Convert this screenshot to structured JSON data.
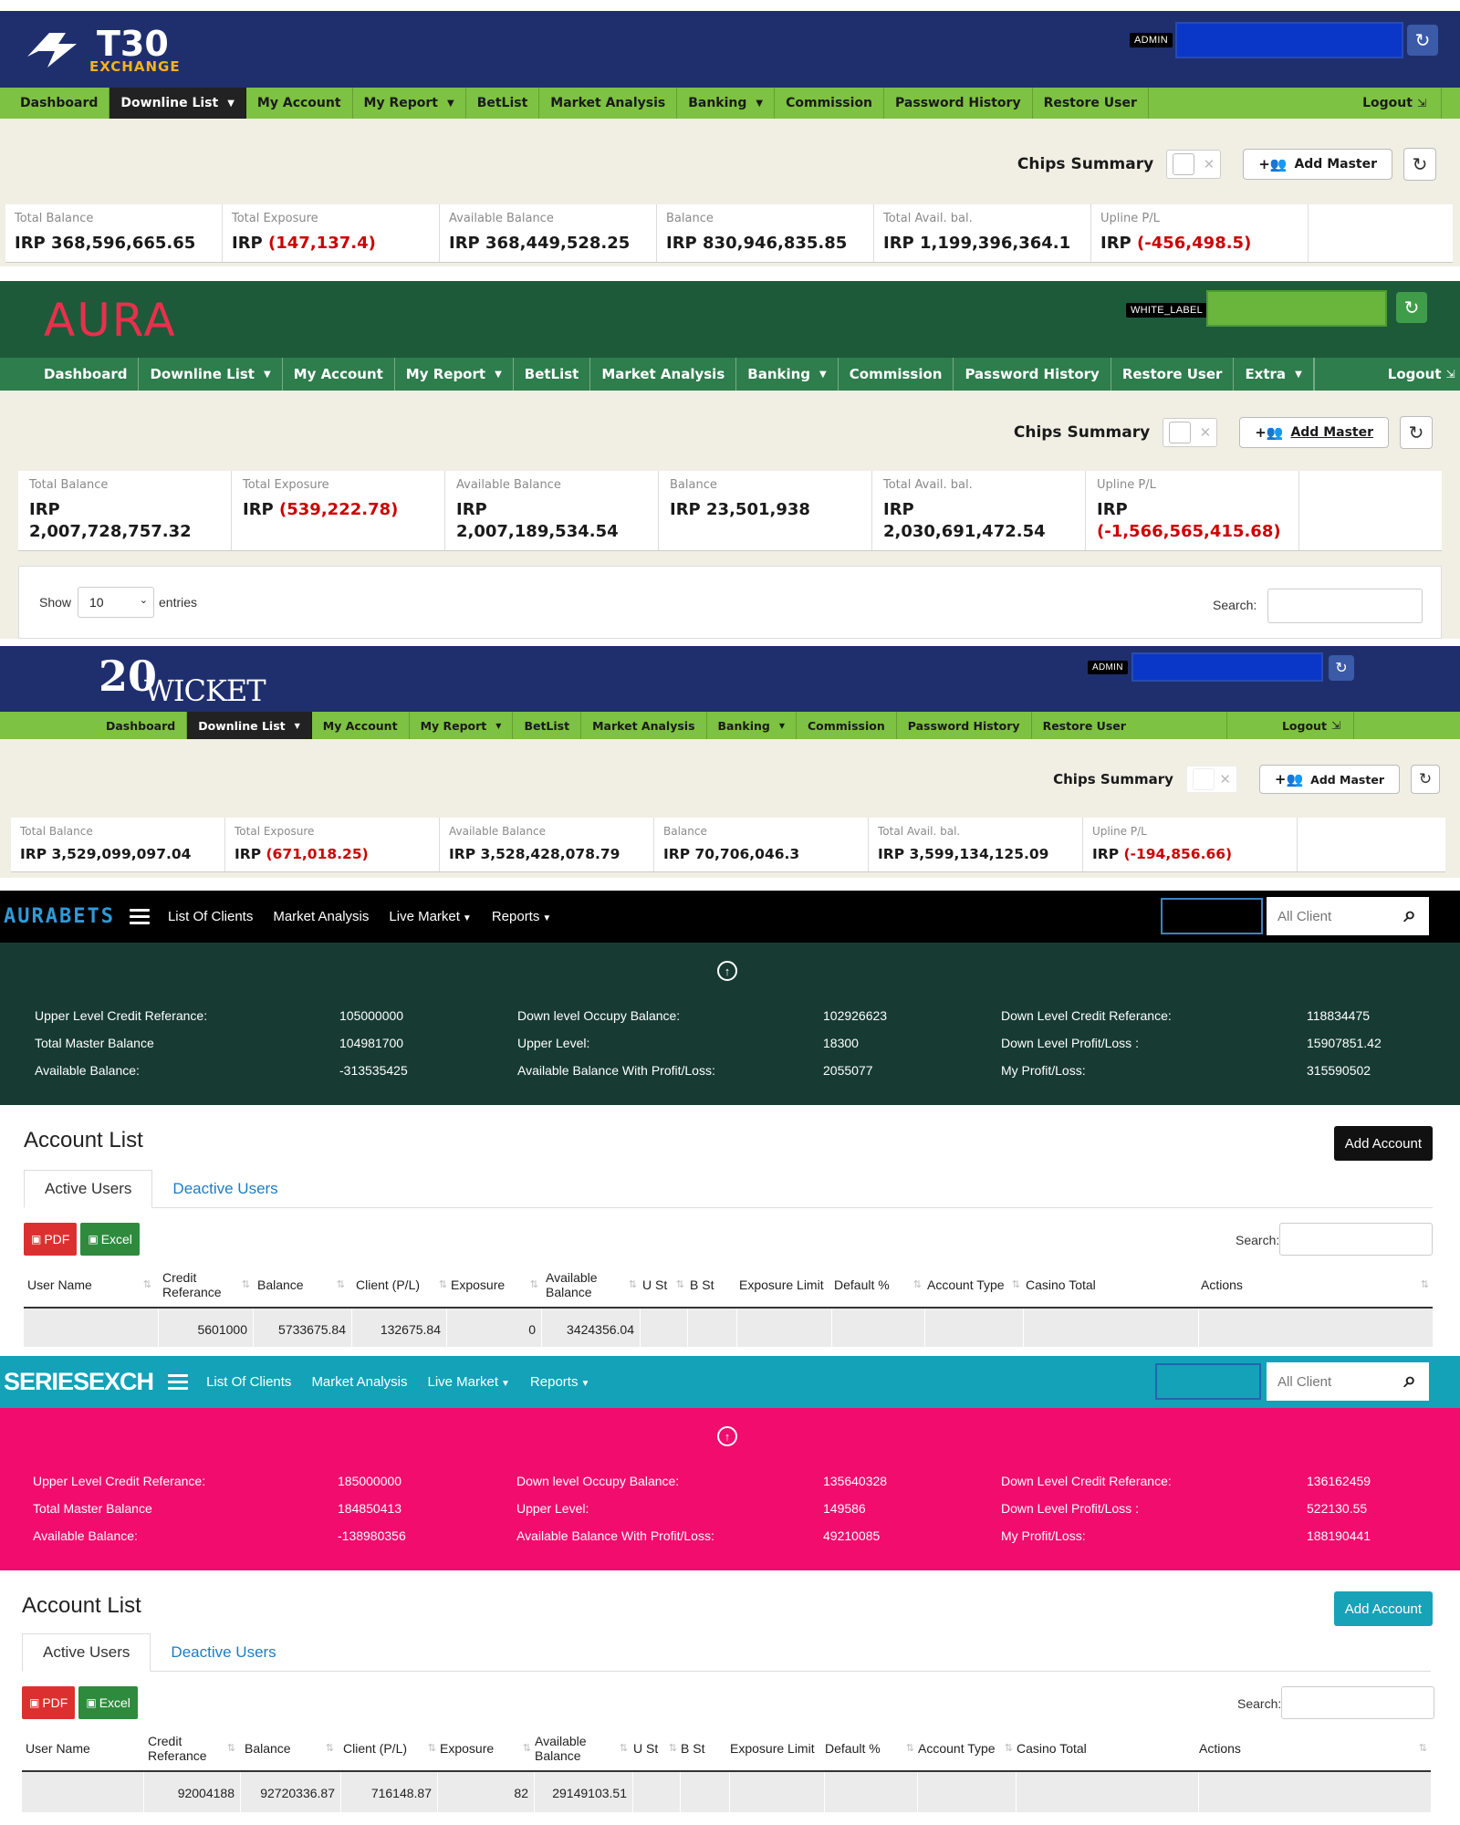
{
  "panels": [
    {
      "logo_main": "T30",
      "logo_sub": "EXCHANGE",
      "role_badge": "ADMIN",
      "nav": [
        {
          "label": "Dashboard"
        },
        {
          "label": "Downline List",
          "caret": true,
          "active": true
        },
        {
          "label": "My Account"
        },
        {
          "label": "My Report",
          "caret": true
        },
        {
          "label": "BetList"
        },
        {
          "label": "Market Analysis"
        },
        {
          "label": "Banking",
          "caret": true
        },
        {
          "label": "Commission"
        },
        {
          "label": "Password History"
        },
        {
          "label": "Restore User"
        }
      ],
      "logout": "Logout",
      "chips_summary": "Chips Summary",
      "add_master": "Add Master",
      "stats": [
        {
          "label": "Total Balance",
          "prefix": "IRP",
          "value": "368,596,665.65"
        },
        {
          "label": "Total Exposure",
          "prefix": "IRP",
          "value": "(147,137.4)",
          "negative": true
        },
        {
          "label": "Available Balance",
          "prefix": "IRP",
          "value": "368,449,528.25"
        },
        {
          "label": "Balance",
          "prefix": "IRP",
          "value": "830,946,835.85"
        },
        {
          "label": "Total Avail. bal.",
          "prefix": "IRP",
          "value": "1,199,396,364.1"
        },
        {
          "label": "Upline P/L",
          "prefix": "IRP",
          "value": "(-456,498.5)",
          "negative": true
        }
      ]
    },
    {
      "logo_main": "AURA",
      "role_badge": "WHITE_LABEL",
      "nav": [
        {
          "label": "Dashboard"
        },
        {
          "label": "Downline List",
          "caret": true
        },
        {
          "label": "My Account"
        },
        {
          "label": "My Report",
          "caret": true
        },
        {
          "label": "BetList"
        },
        {
          "label": "Market Analysis"
        },
        {
          "label": "Banking",
          "caret": true
        },
        {
          "label": "Commission"
        },
        {
          "label": "Password History"
        },
        {
          "label": "Restore User"
        },
        {
          "label": "Extra",
          "caret": true
        }
      ],
      "logout": "Logout",
      "chips_summary": "Chips Summary",
      "add_master": "Add Master",
      "stats": [
        {
          "label": "Total Balance",
          "prefix": "IRP",
          "value": "2,007,728,757.32"
        },
        {
          "label": "Total Exposure",
          "prefix": "IRP",
          "value": "(539,222.78)",
          "negative": true
        },
        {
          "label": "Available Balance",
          "prefix": "IRP",
          "value": "2,007,189,534.54"
        },
        {
          "label": "Balance",
          "prefix": "IRP",
          "value": "23,501,938"
        },
        {
          "label": "Total Avail. bal.",
          "prefix": "IRP",
          "value": "2,030,691,472.54"
        },
        {
          "label": "Upline P/L",
          "prefix": "IRP",
          "value": "(-1,566,565,415.68)",
          "negative": true,
          "wrap": true
        }
      ],
      "show_label": "Show",
      "show_value": "10",
      "entries_label": "entries",
      "search_label": "Search:"
    },
    {
      "logo_main": "WICKET",
      "logo_num": "20",
      "role_badge": "ADMIN",
      "nav": [
        {
          "label": "Dashboard"
        },
        {
          "label": "Downline List",
          "caret": true,
          "active": true
        },
        {
          "label": "My Account"
        },
        {
          "label": "My Report",
          "caret": true
        },
        {
          "label": "BetList"
        },
        {
          "label": "Market Analysis"
        },
        {
          "label": "Banking",
          "caret": true
        },
        {
          "label": "Commission"
        },
        {
          "label": "Password History"
        },
        {
          "label": "Restore User"
        }
      ],
      "logout": "Logout",
      "chips_summary": "Chips Summary",
      "add_master": "Add Master",
      "stats": [
        {
          "label": "Total Balance",
          "prefix": "IRP",
          "value": "3,529,099,097.04"
        },
        {
          "label": "Total Exposure",
          "prefix": "IRP",
          "value": "(671,018.25)",
          "negative": true
        },
        {
          "label": "Available Balance",
          "prefix": "IRP",
          "value": "3,528,428,078.79"
        },
        {
          "label": "Balance",
          "prefix": "IRP",
          "value": "70,706,046.3"
        },
        {
          "label": "Total Avail. bal.",
          "prefix": "IRP",
          "value": "3,599,134,125.09"
        },
        {
          "label": "Upline P/L",
          "prefix": "IRP",
          "value": "(-194,856.66)",
          "negative": true
        }
      ]
    }
  ],
  "client_panels": [
    {
      "brand": "AURABETS",
      "nav": [
        "List Of Clients",
        "Market Analysis",
        "Live Market",
        "Reports"
      ],
      "search_placeholder": "All Client",
      "info": [
        {
          "label": "Upper Level Credit Referance:",
          "value": "105000000"
        },
        {
          "label": "Total Master Balance",
          "value": "104981700"
        },
        {
          "label": "Available Balance:",
          "value": "-313535425"
        },
        {
          "label": "Down level Occupy Balance:",
          "value": "102926623"
        },
        {
          "label": "Upper Level:",
          "value": "18300"
        },
        {
          "label": "Available Balance With Profit/Loss:",
          "value": "2055077"
        },
        {
          "label": "Down Level Credit Referance:",
          "value": "118834475"
        },
        {
          "label": "Down Level Profit/Loss :",
          "value": "15907851.42"
        },
        {
          "label": "My Profit/Loss:",
          "value": "315590502"
        }
      ],
      "title": "Account List",
      "add_account": "Add Account",
      "tabs": [
        "Active Users",
        "Deactive Users"
      ],
      "pdf": "PDF",
      "excel": "Excel",
      "search_label": "Search:",
      "columns": [
        "User Name",
        "Credit Referance",
        "Balance",
        "Client (P/L)",
        "Exposure",
        "Available Balance",
        "U St",
        "B St",
        "Exposure Limit",
        "Default %",
        "Account Type",
        "Casino Total",
        "Actions"
      ],
      "row": [
        "",
        "5601000",
        "5733675.84",
        "132675.84",
        "0",
        "3424356.04",
        "",
        "",
        "",
        "",
        "",
        "",
        ""
      ]
    },
    {
      "brand": "SERIESEXCH",
      "nav": [
        "List Of Clients",
        "Market Analysis",
        "Live Market",
        "Reports"
      ],
      "search_placeholder": "All Client",
      "info": [
        {
          "label": "Upper Level Credit Referance:",
          "value": "185000000"
        },
        {
          "label": "Total Master Balance",
          "value": "184850413"
        },
        {
          "label": "Available Balance:",
          "value": "-138980356"
        },
        {
          "label": "Down level Occupy Balance:",
          "value": "135640328"
        },
        {
          "label": "Upper Level:",
          "value": "149586"
        },
        {
          "label": "Available Balance With Profit/Loss:",
          "value": "49210085"
        },
        {
          "label": "Down Level Credit Referance:",
          "value": "136162459"
        },
        {
          "label": "Down Level Profit/Loss :",
          "value": "522130.55"
        },
        {
          "label": "My Profit/Loss:",
          "value": "188190441"
        }
      ],
      "title": "Account List",
      "add_account": "Add Account",
      "tabs": [
        "Active Users",
        "Deactive Users"
      ],
      "pdf": "PDF",
      "excel": "Excel",
      "search_label": "Search:",
      "columns": [
        "User Name",
        "Credit Referance",
        "Balance",
        "Client (P/L)",
        "Exposure",
        "Available Balance",
        "U St",
        "B St",
        "Exposure Limit",
        "Default %",
        "Account Type",
        "Casino Total",
        "Actions"
      ],
      "row": [
        "",
        "92004188",
        "92720336.87",
        "716148.87",
        "82",
        "29149103.51",
        "",
        "",
        "",
        "",
        "",
        "",
        ""
      ]
    }
  ],
  "theme": {
    "t30_header": "#1f2f6e",
    "aura_header": "#1d5a3a",
    "wicket_header": "#1f2f6e",
    "nav_green": "#7dc242",
    "aura_nav": "#2e7d4c",
    "aurabets_top": "#000000",
    "aurabets_info": "#173b33",
    "aurabets_accent": "#111111",
    "series_top": "#13a2b8",
    "series_info": "#f20c6e",
    "series_accent": "#17a2b8",
    "negative": "#cc0000"
  }
}
